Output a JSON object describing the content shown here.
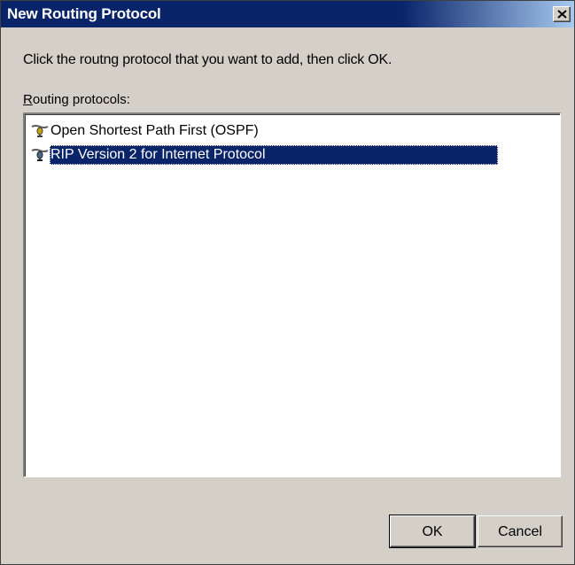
{
  "dialog": {
    "title": "New Routing Protocol",
    "instruction": "Click the routng protocol that you want to add, then click OK.",
    "list_label_accel": "R",
    "list_label_rest": "outing protocols:",
    "protocols": [
      {
        "label": "Open Shortest Path First (OSPF)",
        "icon": "routing-protocol-icon",
        "selected": false
      },
      {
        "label": "RIP Version 2 for Internet Protocol",
        "icon": "routing-protocol-icon",
        "selected": true
      }
    ],
    "ok_label": "OK",
    "cancel_label": "Cancel"
  },
  "colors": {
    "titlebar_start": "#0a246a",
    "titlebar_end": "#a6caf0",
    "selection": "#0a246a",
    "face": "#d4d0c8"
  }
}
